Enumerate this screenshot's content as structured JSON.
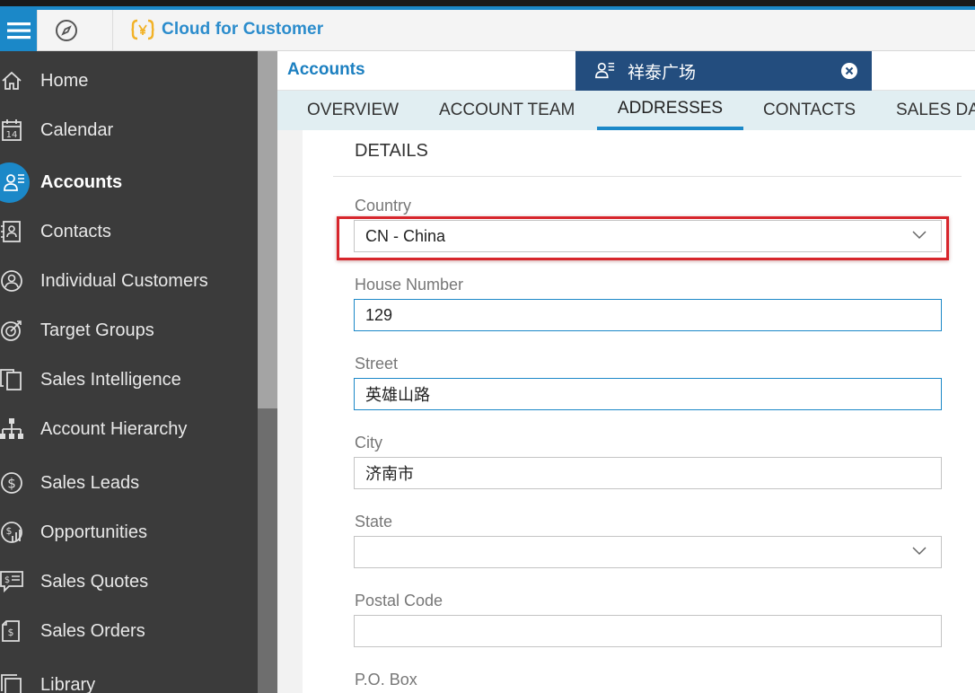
{
  "shell": {
    "app_name": "Cloud for Customer",
    "colors": {
      "brand": "#1b88c8",
      "sidebar_bg": "#3b3b3b",
      "record_tab_bg": "#234d7e",
      "highlight": "#d7262c",
      "logo_yellow": "#f2b227"
    },
    "icons": {
      "menu": "hamburger-icon",
      "compass": "compass-icon",
      "logo": "logo-icon"
    }
  },
  "sidebar": {
    "items": [
      {
        "label": "Home",
        "icon": "home-icon"
      },
      {
        "label": "Calendar",
        "icon": "calendar-icon",
        "icon_text": "14"
      },
      {
        "label": "Accounts",
        "icon": "account-icon",
        "active": true
      },
      {
        "label": "Contacts",
        "icon": "contacts-icon"
      },
      {
        "label": "Individual Customers",
        "icon": "person-icon"
      },
      {
        "label": "Target Groups",
        "icon": "target-icon"
      },
      {
        "label": "Sales Intelligence",
        "icon": "copy-icon"
      },
      {
        "label": "Account Hierarchy",
        "icon": "hierarchy-icon"
      },
      {
        "label": "Sales Leads",
        "icon": "dollar-icon"
      },
      {
        "label": "Opportunities",
        "icon": "opportunity-icon"
      },
      {
        "label": "Sales Quotes",
        "icon": "quote-icon"
      },
      {
        "label": "Sales Orders",
        "icon": "order-icon"
      },
      {
        "label": "Library",
        "icon": "library-icon"
      }
    ]
  },
  "header": {
    "title": "Accounts",
    "record_tab": {
      "label": "祥泰广场",
      "icon": "account-icon",
      "close_icon": "close-icon"
    }
  },
  "tabs": [
    {
      "label": "OVERVIEW"
    },
    {
      "label": "ACCOUNT TEAM"
    },
    {
      "label": "ADDRESSES",
      "selected": true
    },
    {
      "label": "CONTACTS"
    },
    {
      "label": "SALES DA"
    }
  ],
  "details": {
    "title": "DETAILS",
    "fields": {
      "country": {
        "label": "Country",
        "value": "CN - China"
      },
      "house_number": {
        "label": "House Number",
        "value": "129"
      },
      "street": {
        "label": "Street",
        "value": "英雄山路"
      },
      "city": {
        "label": "City",
        "value": "济南市"
      },
      "state": {
        "label": "State",
        "value": ""
      },
      "postal_code": {
        "label": "Postal Code",
        "value": ""
      },
      "po_box": {
        "label": "P.O. Box"
      }
    }
  }
}
